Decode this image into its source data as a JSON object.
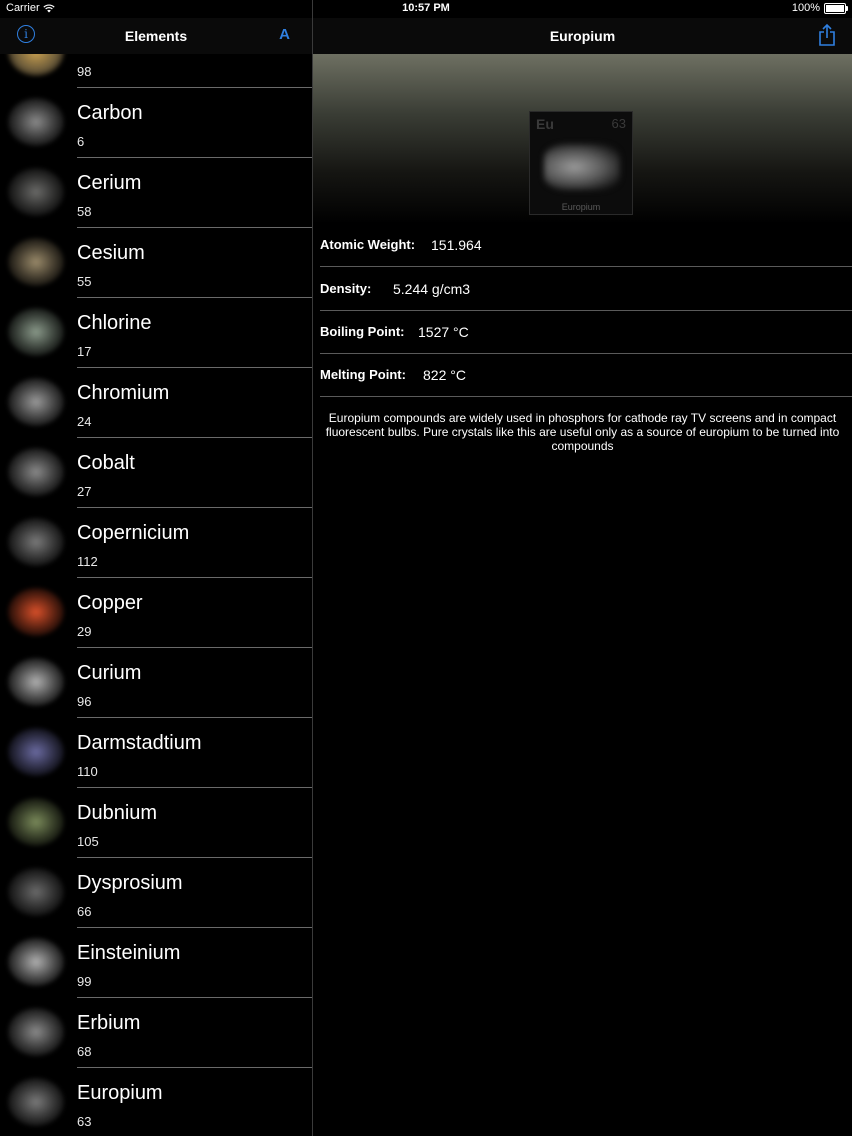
{
  "status_bar": {
    "carrier": "Carrier",
    "time": "10:57 PM",
    "battery": "100%"
  },
  "left_nav": {
    "title": "Elements",
    "info_icon": "info-icon",
    "sort_label": "A"
  },
  "list": {
    "top_partial_number": "98",
    "items": [
      {
        "name": "Carbon",
        "number": "6",
        "color": "#8a8a8a"
      },
      {
        "name": "Cerium",
        "number": "58",
        "color": "#6a6a68"
      },
      {
        "name": "Cesium",
        "number": "55",
        "color": "#9a8a6a"
      },
      {
        "name": "Chlorine",
        "number": "17",
        "color": "#8a9a8a"
      },
      {
        "name": "Chromium",
        "number": "24",
        "color": "#9a9a9a"
      },
      {
        "name": "Cobalt",
        "number": "27",
        "color": "#8a8a8a"
      },
      {
        "name": "Copernicium",
        "number": "112",
        "color": "#7a7a7a"
      },
      {
        "name": "Copper",
        "number": "29",
        "color": "#d8502a"
      },
      {
        "name": "Curium",
        "number": "96",
        "color": "#b0b0b0"
      },
      {
        "name": "Darmstadtium",
        "number": "110",
        "color": "#6a6aa0"
      },
      {
        "name": "Dubnium",
        "number": "105",
        "color": "#7a8a5a"
      },
      {
        "name": "Dysprosium",
        "number": "66",
        "color": "#6a6a6a"
      },
      {
        "name": "Einsteinium",
        "number": "99",
        "color": "#b0b0b0"
      },
      {
        "name": "Erbium",
        "number": "68",
        "color": "#8a8a8a"
      },
      {
        "name": "Europium",
        "number": "63",
        "color": "#7a7a7a"
      }
    ]
  },
  "detail": {
    "title": "Europium",
    "share_icon": "share-icon",
    "tile": {
      "symbol": "Eu",
      "number": "63",
      "name": "Europium"
    },
    "properties": [
      {
        "label": "Atomic Weight:",
        "value": "151.964"
      },
      {
        "label": "Density:",
        "value": "5.244 g/cm3"
      },
      {
        "label": "Boiling Point:",
        "value": "1527 °C"
      },
      {
        "label": "Melting Point:",
        "value": "822 °C"
      }
    ],
    "description": "Europium compounds are widely used in phosphors for cathode ray TV screens and in compact fluorescent bulbs.  Pure crystals like this are useful only as a source of europium to be turned into compounds"
  },
  "colors": {
    "accent": "#2f7fe0",
    "background": "#000000"
  }
}
